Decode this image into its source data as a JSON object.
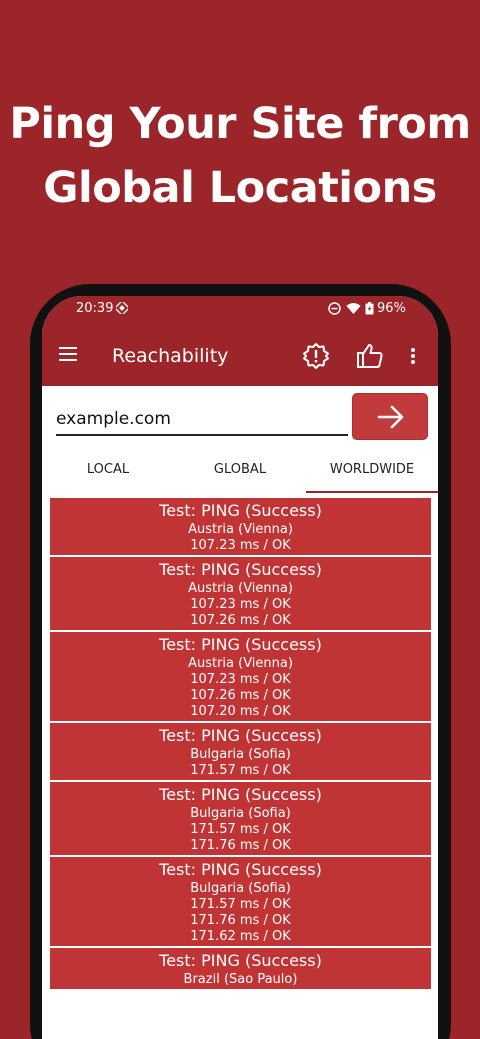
{
  "headline": {
    "line1": "Ping Your Site from",
    "line2": "Global Locations"
  },
  "status_bar": {
    "time": "20:39",
    "battery": "96%"
  },
  "toolbar": {
    "title": "Reachability"
  },
  "url_input": {
    "value": "example.com"
  },
  "tabs": [
    {
      "label": "LOCAL",
      "active": false
    },
    {
      "label": "GLOBAL",
      "active": false
    },
    {
      "label": "WORLDWIDE",
      "active": true
    }
  ],
  "results": [
    {
      "title": "Test: PING (Success)",
      "location": "Austria (Vienna)",
      "pings": [
        "107.23 ms / OK"
      ]
    },
    {
      "title": "Test: PING (Success)",
      "location": "Austria (Vienna)",
      "pings": [
        "107.23 ms / OK",
        "107.26 ms / OK"
      ]
    },
    {
      "title": "Test: PING (Success)",
      "location": "Austria (Vienna)",
      "pings": [
        "107.23 ms / OK",
        "107.26 ms / OK",
        "107.20 ms / OK"
      ]
    },
    {
      "title": "Test: PING (Success)",
      "location": "Bulgaria (Sofia)",
      "pings": [
        "171.57 ms / OK"
      ]
    },
    {
      "title": "Test: PING (Success)",
      "location": "Bulgaria (Sofia)",
      "pings": [
        "171.57 ms / OK",
        "171.76 ms / OK"
      ]
    },
    {
      "title": "Test: PING (Success)",
      "location": "Bulgaria (Sofia)",
      "pings": [
        "171.57 ms / OK",
        "171.76 ms / OK",
        "171.62 ms / OK"
      ]
    },
    {
      "title": "Test: PING (Success)",
      "location": "Brazil (Sao Paulo)",
      "pings": []
    }
  ],
  "colors": {
    "background": "#9b2528",
    "card": "#c13436",
    "button": "#c13a3c"
  },
  "icons": [
    "menu-icon",
    "alert-badge-icon",
    "thumbs-up-icon",
    "more-vert-icon",
    "arrow-right-icon",
    "wifi-icon",
    "battery-icon",
    "dnd-icon"
  ]
}
